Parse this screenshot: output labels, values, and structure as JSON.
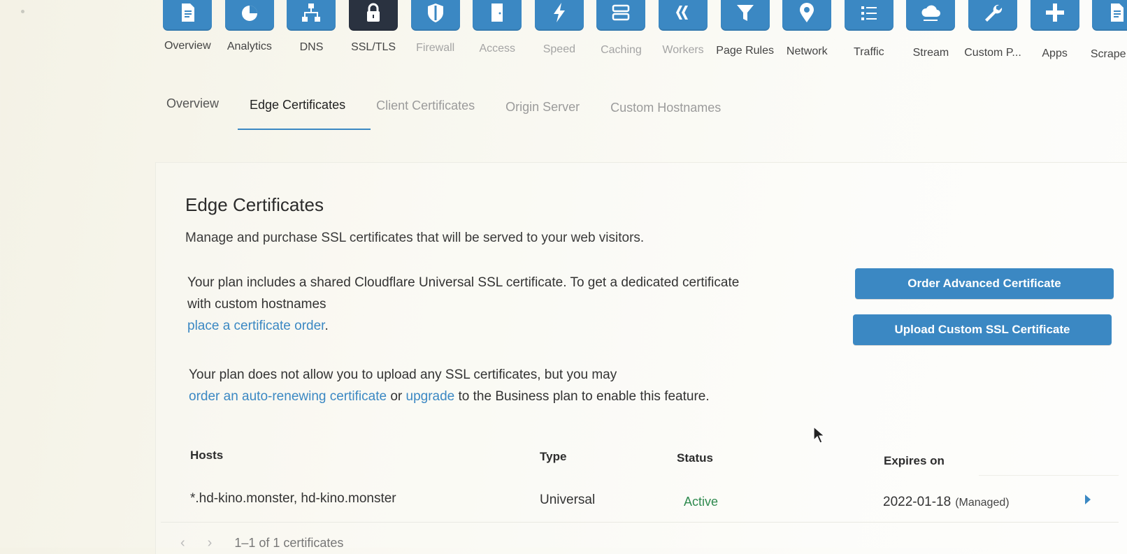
{
  "apps": [
    {
      "label": "Overview",
      "icon": "document-icon",
      "state": "normal"
    },
    {
      "label": "Analytics",
      "icon": "pie-chart-icon",
      "state": "normal"
    },
    {
      "label": "DNS",
      "icon": "network-tree-icon",
      "state": "normal"
    },
    {
      "label": "SSL/TLS",
      "icon": "lock-icon",
      "state": "active"
    },
    {
      "label": "Firewall",
      "icon": "shield-icon",
      "state": "dim"
    },
    {
      "label": "Access",
      "icon": "door-icon",
      "state": "dim"
    },
    {
      "label": "Speed",
      "icon": "lightning-icon",
      "state": "dim"
    },
    {
      "label": "Caching",
      "icon": "server-icon",
      "state": "dim"
    },
    {
      "label": "Workers",
      "icon": "workers-icon",
      "state": "dim"
    },
    {
      "label": "Page Rules",
      "icon": "filter-icon",
      "state": "normal"
    },
    {
      "label": "Network",
      "icon": "location-pin-icon",
      "state": "normal"
    },
    {
      "label": "Traffic",
      "icon": "list-icon",
      "state": "normal"
    },
    {
      "label": "Stream",
      "icon": "cloud-icon",
      "state": "normal"
    },
    {
      "label": "Custom P...",
      "icon": "wrench-icon",
      "state": "normal"
    },
    {
      "label": "Apps",
      "icon": "plus-icon",
      "state": "normal"
    },
    {
      "label": "Scrape Sh",
      "icon": "document-icon",
      "state": "normal"
    }
  ],
  "tabs": [
    {
      "label": "Overview",
      "state": "normal"
    },
    {
      "label": "Edge Certificates",
      "state": "active"
    },
    {
      "label": "Client Certificates",
      "state": "dim"
    },
    {
      "label": "Origin Server",
      "state": "dim"
    },
    {
      "label": "Custom Hostnames",
      "state": "dim"
    }
  ],
  "section": {
    "title": "Edge Certificates",
    "description": "Manage and purchase SSL certificates that will be served to your web visitors.",
    "plan_text_1": "Your plan includes a shared Cloudflare Universal SSL certificate. To get a dedicated certificate with custom hostnames",
    "plan_link_1": "place a certificate order",
    "plan_text_1_end": ".",
    "plan_text_2": "Your plan does not allow you to upload any SSL certificates, but you may",
    "plan_link_2": "order an auto-renewing certificate",
    "plan_text_2_mid": " or ",
    "plan_link_3": "upgrade",
    "plan_text_2_end": " to the Business plan to enable this feature."
  },
  "buttons": {
    "order_advanced": "Order Advanced Certificate",
    "upload_custom": "Upload Custom SSL Certificate"
  },
  "table": {
    "headers": {
      "hosts": "Hosts",
      "type": "Type",
      "status": "Status",
      "expires": "Expires on"
    },
    "rows": [
      {
        "hosts": "*.hd-kino.monster, hd-kino.monster",
        "type": "Universal",
        "status": "Active",
        "expires": "2022-01-18",
        "note": "(Managed)"
      }
    ]
  },
  "pagination": {
    "summary": "1–1 of 1 certificates",
    "prev": "‹",
    "next": "›"
  },
  "colors": {
    "accent": "#3b88c3",
    "active_tile": "#2a3240",
    "status_active": "#2f8a4f"
  }
}
